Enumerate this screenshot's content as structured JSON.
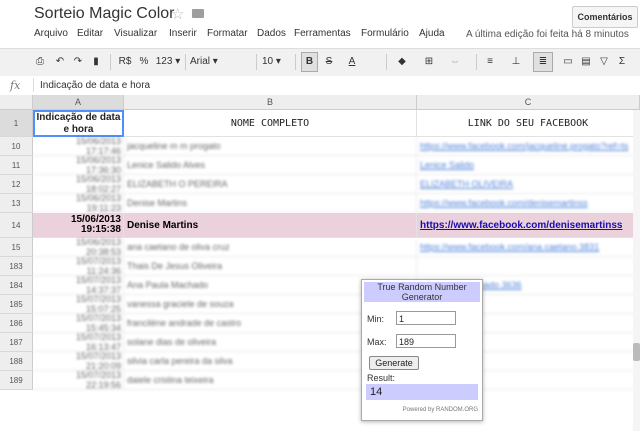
{
  "doc": {
    "title": "Sorteio Magic Color",
    "star_icon": "star-icon",
    "folder_icon": "folder-icon",
    "comments_label": "Comentários"
  },
  "menu": [
    "Arquivo",
    "Editar",
    "Visualizar",
    "Inserir",
    "Formatar",
    "Dados",
    "Ferramentas",
    "Formulário",
    "Ajuda"
  ],
  "last_edit": "A última edição foi feita há 8 minutos",
  "toolbar": {
    "currency": "R$",
    "percent": "%",
    "number_format": "123 ▾",
    "font": "Arial ▾",
    "font_size": "10 ▾",
    "bold": "B",
    "strike": "S",
    "text_color": "A"
  },
  "formula": {
    "fx": "fx",
    "value": "Indicação de data e hora"
  },
  "columns": {
    "a": "A",
    "b": "B",
    "c": "C"
  },
  "header": {
    "row_num": "1",
    "a": "Indicação de data e hora",
    "b": "NOME COMPLETO",
    "c": "LINK DO SEU FACEBOOK"
  },
  "rows": [
    {
      "num": "10",
      "date": "15/06/2013",
      "time": "17:17:46",
      "name": "jacqueline m m progato",
      "link": "https://www.facebook.com/jacqueline.progato?ref=ts"
    },
    {
      "num": "11",
      "date": "15/06/2013",
      "time": "17:36:30",
      "name": "Lenice Salido Alves",
      "link": "Lenice Salido"
    },
    {
      "num": "12",
      "date": "15/06/2013",
      "time": "18:02:27",
      "name": "ELIZABETH O PEREIRA",
      "link": "ELIZABETH OLIVEIRA"
    },
    {
      "num": "13",
      "date": "15/06/2013",
      "time": "19:11:23",
      "name": "Denise Martins",
      "link": "https://www.facebook.com/denisemartinss"
    },
    {
      "num": "14",
      "date": "15/06/2013",
      "time": "19:15:38",
      "name": "Denise Martins",
      "link": "https://www.facebook.com/denisemartinss",
      "highlight": true
    },
    {
      "num": "15",
      "date": "15/06/2013",
      "time": "20:38:53",
      "name": "ana caetano de oliva cruz",
      "link": "https://www.facebook.com/ana.caetano.3831"
    },
    {
      "num": "183",
      "date": "15/07/2013",
      "time": "11:24:36",
      "name": "Thais De Jesus Oliveira",
      "link": ""
    },
    {
      "num": "184",
      "date": "15/07/2013",
      "time": "14:37:37",
      "name": "Ana Paula Machado",
      "link": "ana.paula.machado.3636"
    },
    {
      "num": "185",
      "date": "15/07/2013",
      "time": "15:07:25",
      "name": "vanessa graciele de souza",
      "link": ""
    },
    {
      "num": "186",
      "date": "15/07/2013",
      "time": "15:45:34",
      "name": "franciléne andrade de castro",
      "link": ""
    },
    {
      "num": "187",
      "date": "15/07/2013",
      "time": "16:13:47",
      "name": "solane dias de oliveira",
      "link": ""
    },
    {
      "num": "188",
      "date": "15/07/2013",
      "time": "21:20:09",
      "name": "silvia carla pereira da silva",
      "link": ""
    },
    {
      "num": "189",
      "date": "15/07/2013",
      "time": "22:19:56",
      "name": "daiele cristina teixeira",
      "link": ""
    }
  ],
  "widget": {
    "title": "True Random Number Generator",
    "min_label": "Min:",
    "min_value": "1",
    "max_label": "Max:",
    "max_value": "189",
    "generate_label": "Generate",
    "result_label": "Result:",
    "result_value": "14",
    "powered": "Powered by RANDOM.ORG"
  },
  "colors": {
    "highlight": "#ead1dc",
    "widget_accent": "#ccccff",
    "link": "#1155cc"
  }
}
